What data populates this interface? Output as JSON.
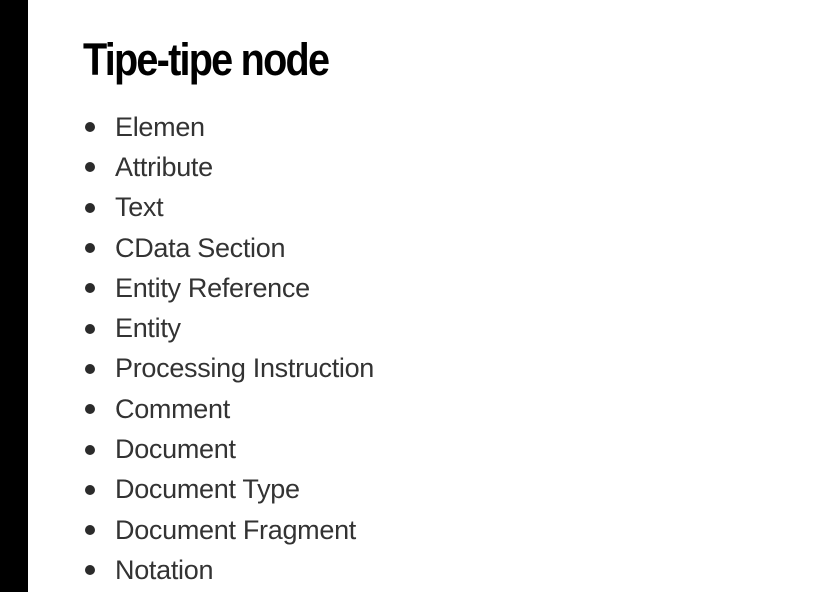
{
  "slide": {
    "title": "Tipe-tipe node",
    "items": [
      "Elemen",
      "Attribute",
      "Text",
      "CData Section",
      "Entity Reference",
      "Entity",
      "Processing Instruction",
      "Comment",
      "Document",
      "Document Type",
      "Document Fragment",
      "Notation"
    ]
  }
}
